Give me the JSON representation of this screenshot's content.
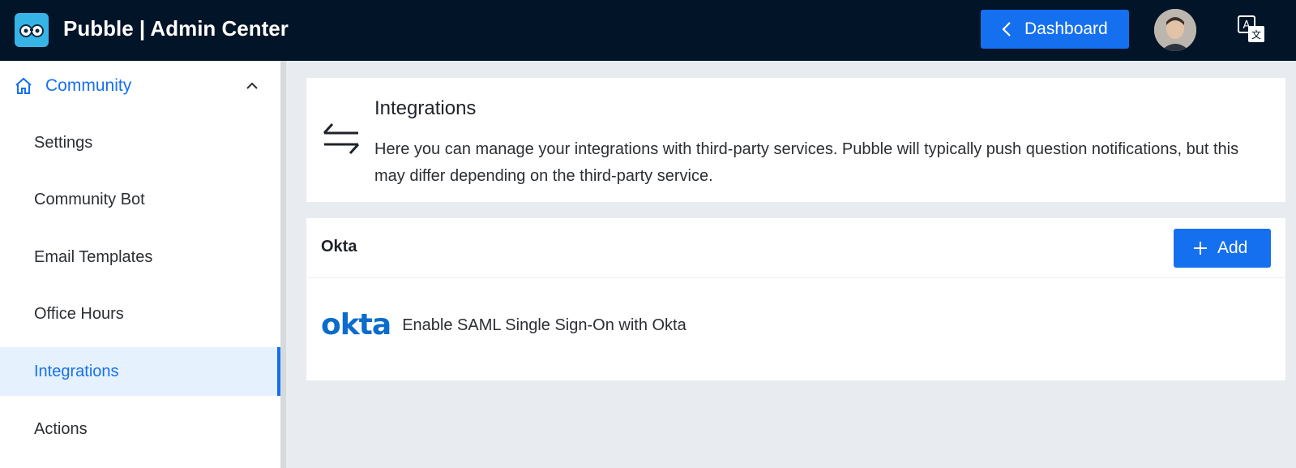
{
  "header": {
    "app_title": "Pubble | Admin Center",
    "dashboard_label": "Dashboard",
    "logo_icon": "owl-logo-icon",
    "avatar_icon": "user-avatar",
    "translate_icon": "translate-icon"
  },
  "sidebar": {
    "group_label": "Community",
    "items": [
      {
        "label": "Settings"
      },
      {
        "label": "Community Bot"
      },
      {
        "label": "Email Templates"
      },
      {
        "label": "Office Hours"
      },
      {
        "label": "Integrations",
        "active": true
      },
      {
        "label": "Actions"
      }
    ]
  },
  "intro": {
    "heading": "Integrations",
    "description": "Here you can manage your integrations with third-party services. Pubble will typically push question notifications, but this may differ depending on the third-party service."
  },
  "okta": {
    "title": "Okta",
    "add_label": "Add",
    "logo_text": "okta",
    "row_text": "Enable SAML Single Sign-On with Okta"
  },
  "colors": {
    "header_bg": "#021428",
    "accent": "#1570ef",
    "active_bg": "#e6f1fe",
    "okta_blue": "#0b6ccc"
  }
}
